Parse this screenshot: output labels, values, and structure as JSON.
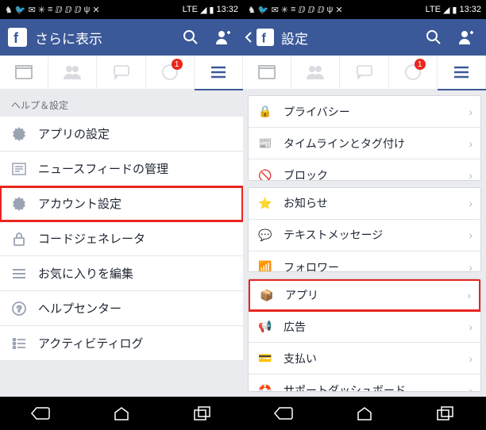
{
  "status": {
    "time": "13:32",
    "signal": "LTE"
  },
  "left": {
    "title": "さらに表示",
    "badge": "1",
    "section": "ヘルプ＆設定",
    "items": [
      {
        "label": "アプリの設定"
      },
      {
        "label": "ニュースフィードの管理"
      },
      {
        "label": "アカウント設定",
        "highlight": true
      },
      {
        "label": "コードジェネレータ"
      },
      {
        "label": "お気に入りを編集"
      },
      {
        "label": "ヘルプセンター"
      },
      {
        "label": "アクティビティログ"
      }
    ]
  },
  "right": {
    "title": "設定",
    "badge": "1",
    "group1": [
      {
        "label": "プライバシー"
      },
      {
        "label": "タイムラインとタグ付け"
      },
      {
        "label": "ブロック"
      }
    ],
    "group2": [
      {
        "label": "お知らせ"
      },
      {
        "label": "テキストメッセージ"
      },
      {
        "label": "フォロワー"
      }
    ],
    "group3": [
      {
        "label": "アプリ",
        "highlight": true
      },
      {
        "label": "広告"
      },
      {
        "label": "支払い"
      },
      {
        "label": "サポートダッシュボード"
      }
    ]
  }
}
